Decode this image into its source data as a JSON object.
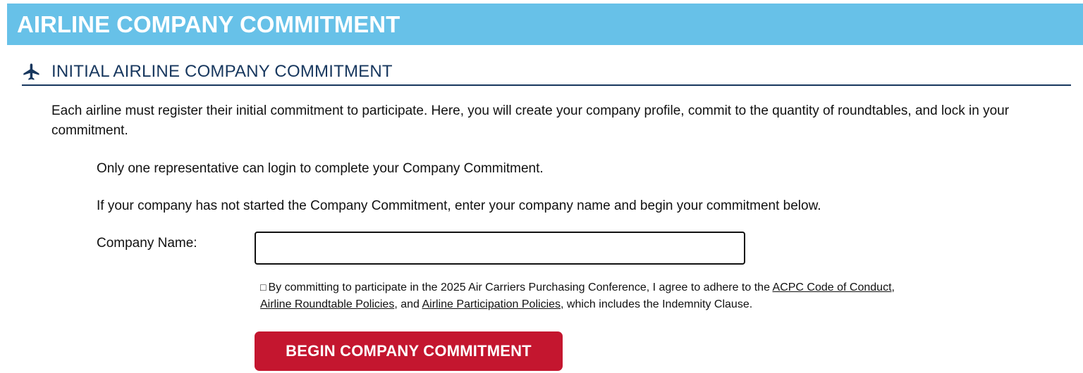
{
  "header": {
    "title": "AIRLINE COMPANY COMMITMENT"
  },
  "section": {
    "title": "INITIAL AIRLINE COMPANY COMMITMENT",
    "icon": "airplane-icon"
  },
  "content": {
    "intro": "Each airline must register their initial commitment to participate. Here, you will create your company profile, commit to the quantity of roundtables, and lock in your commitment.",
    "note_one_rep": "Only one representative can login to complete your Company Commitment.",
    "note_not_started": "If your company has not started the Company Commitment, enter your company name and begin your commitment below."
  },
  "form": {
    "company_name_label": "Company Name:",
    "company_name_value": "",
    "company_name_placeholder": "",
    "agreement": {
      "checkbox_glyph": "□",
      "text_before": "By committing to participate in the 2025 Air Carriers Purchasing Conference, I agree to adhere to the ",
      "link_code_of_conduct": "ACPC Code of Conduct",
      "sep1": ", ",
      "link_roundtable_policies": "Airline Roundtable Policies",
      "sep2": ", and ",
      "link_participation_policies": "Airline Participation Policies",
      "text_after": ", which includes the Indemnity Clause."
    },
    "submit_label": "BEGIN COMPANY COMMITMENT"
  },
  "colors": {
    "banner": "#67c1e8",
    "section_heading": "#17375e",
    "button": "#c4162f"
  }
}
